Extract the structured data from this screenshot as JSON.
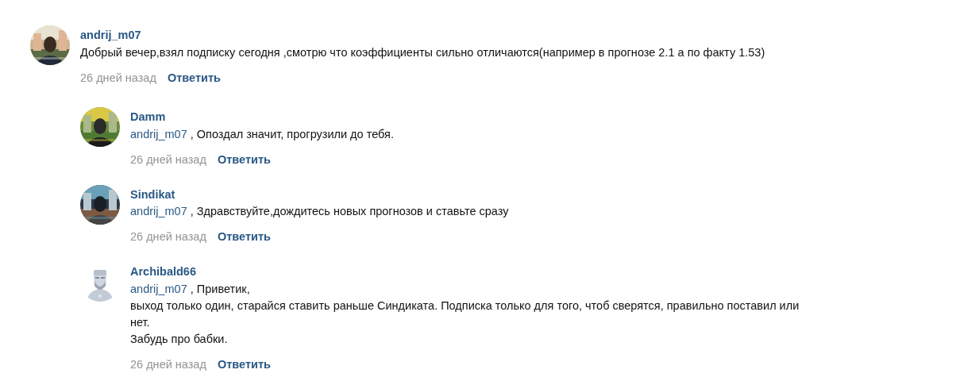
{
  "comments": [
    {
      "author": "andrij_m07",
      "lines": [
        {
          "text": "Добрый вечер,взял подписку сегодня ,смотрю что коэффициенты сильно  отличаются(например в прогнозе 2.1 а по факту 1.53)"
        }
      ],
      "time": "26 дней назад",
      "reply_label": "Ответить",
      "replies": [
        {
          "author": "Damm",
          "lines": [
            {
              "mention": "andrij_m07",
              "text": " , Опоздал значит, прогрузили до тебя."
            }
          ],
          "time": "26 дней назад",
          "reply_label": "Ответить"
        },
        {
          "author": "Sindikat",
          "lines": [
            {
              "mention": "andrij_m07",
              "text": " , Здравствуйте,дождитесь новых прогнозов и ставьте сразу"
            }
          ],
          "time": "26 дней назад",
          "reply_label": "Ответить"
        },
        {
          "author": "Archibald66",
          "avatar": {
            "kind": "icon"
          },
          "lines": [
            {
              "mention": "andrij_m07",
              "text": " , Приветик,"
            },
            {
              "text": "выход только один, старайся ставить раньше Синдиката. Подписка только для того, чтоб сверятся, правильно поставил или нет."
            },
            {
              "text": "Забудь про бабки."
            }
          ],
          "time": "26 дней назад",
          "reply_label": "Ответить"
        }
      ]
    }
  ]
}
